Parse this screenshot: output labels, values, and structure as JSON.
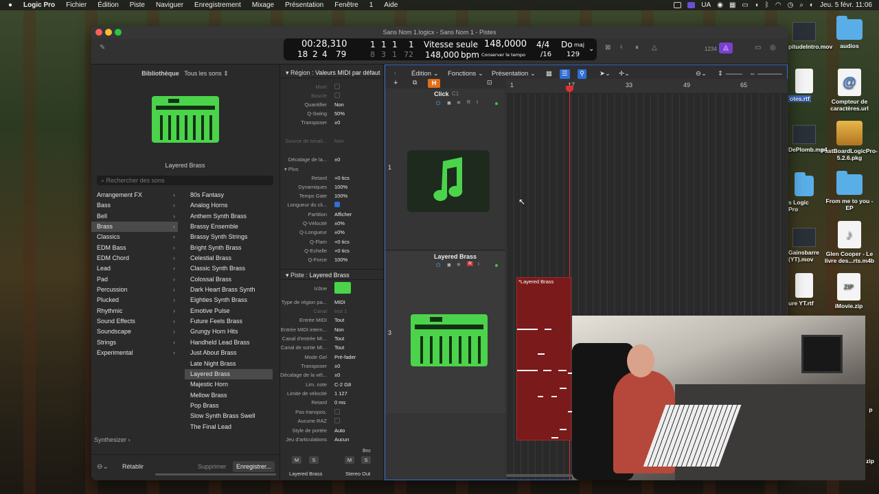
{
  "menubar": {
    "app": "Logic Pro",
    "items": [
      "Fichier",
      "Édition",
      "Piste",
      "Naviguer",
      "Enregistrement",
      "Mixage",
      "Présentation",
      "Fenêtre",
      "1",
      "Aide"
    ],
    "status": {
      "lang": "UA",
      "datetime": "Jeu. 5 févr. 11:06"
    }
  },
  "window": {
    "title": "Sans Nom 1.logicx - Sans Nom 1 - Pistes"
  },
  "lcd": {
    "time": "00:28,310",
    "bars_top": [
      "1",
      "1",
      "1",
      "1"
    ],
    "bars_bottom": [
      "18",
      "2",
      "4",
      "79"
    ],
    "bars2_bottom": [
      "8",
      "3",
      "1",
      "72"
    ],
    "tempo_label": "Vitesse seule",
    "tempo_top": "148,0000",
    "tempo_bottom": "148,000",
    "bpm": "bpm",
    "keep_tempo": "Conserver le tempo",
    "sig_top": "4/4",
    "sig_bottom": "/16",
    "key": "Do",
    "mode": "maj",
    "val": "129",
    "count_in": "1234"
  },
  "library": {
    "title": "Bibliothèque",
    "filter": "Tous les sons ⇕",
    "patch_name": "Layered Brass",
    "search_placeholder": "Rechercher des sons",
    "categories": [
      "Arrangement FX",
      "Bass",
      "Bell",
      "Brass",
      "Classics",
      "EDM Bass",
      "EDM Chord",
      "Lead",
      "Pad",
      "Percussion",
      "Plucked",
      "Rhythmic",
      "Sound Effects",
      "Soundscape",
      "Strings",
      "Experimental"
    ],
    "patches": [
      "80s Fantasy",
      "Analog Horns",
      "Anthem Synth Brass",
      "Brassy Ensemble",
      "Brassy Synth Strings",
      "Bright Synth Brass",
      "Celestial Brass",
      "Classic Synth Brass",
      "Colossal Brass",
      "Dark Heart Brass Synth",
      "Eighties Synth Brass",
      "Emotive Pulse",
      "Future Feels Brass",
      "Grungy Horn Hits",
      "Handheld Lead Brass",
      "Just About Brass",
      "Late Night Brass",
      "Layered Brass",
      "Majestic Horn",
      "Mellow Brass",
      "Pop Brass",
      "Slow Synth Brass Swell",
      "The Final Lead"
    ],
    "synth": "Synthesizer ›",
    "reset": "Rétablir",
    "delete": "Supprimer",
    "save": "Enregistrer..."
  },
  "inspector": {
    "region_label": "Région :",
    "region_value": "Valeurs MIDI par défaut",
    "region_rows": [
      [
        "Muet",
        ""
      ],
      [
        "Boucle",
        ""
      ],
      [
        "Quantifier",
        "Non"
      ],
      [
        "Q-Swing",
        "50%"
      ],
      [
        "Transposer",
        "±0"
      ],
      [
        "Source de tonali...",
        "Non"
      ],
      [
        "Décalage de la...",
        "±0"
      ]
    ],
    "plus": "Plus",
    "more_rows": [
      [
        "Retard",
        "+0 tics"
      ],
      [
        "Dynamiques",
        "100%"
      ],
      [
        "Temps Gate",
        "100%"
      ],
      [
        "Longueur du cli...",
        ""
      ],
      [
        "Partition",
        "Afficher"
      ],
      [
        "Q-Vélocité",
        "±0%"
      ],
      [
        "Q-Longueur",
        "±0%"
      ],
      [
        "Q-Flam",
        "+0 tics"
      ],
      [
        "Q-Echelle",
        "+0 tics"
      ],
      [
        "Q-Force",
        "100%"
      ]
    ],
    "track_label": "Piste :",
    "track_value": "Layered Brass",
    "track_rows": [
      [
        "Icône",
        ""
      ],
      [
        "Type de région pa...",
        "MIDI"
      ],
      [
        "Canal",
        "Inst 1"
      ],
      [
        "Entrée MIDI",
        "Tout"
      ],
      [
        "Entrée MIDI intern...",
        "Non"
      ],
      [
        "Canal d'entrée MI...",
        "Tout"
      ],
      [
        "Canal de sortie MI...",
        "Tout"
      ],
      [
        "Mode Gel",
        "Pré-fader"
      ],
      [
        "Transposer",
        "±0"
      ],
      [
        "Décalage de la vél...",
        "±0"
      ],
      [
        "Lim. note",
        "C-2  G8"
      ],
      [
        "Limite de vélocité",
        "1  127"
      ],
      [
        "Retard",
        "0 ms"
      ],
      [
        "Pas transpos.",
        ""
      ],
      [
        "Aucune RAZ",
        ""
      ],
      [
        "Style de portée",
        "Auto"
      ],
      [
        "Jeu d'articulations",
        "Aucun"
      ]
    ],
    "bnc": "Bnc",
    "m": "M",
    "s": "S",
    "strip1": "Layered Brass",
    "strip2": "Stereo Out"
  },
  "main": {
    "edit": "Édition",
    "functions": "Fonctions",
    "view": "Présentation",
    "tracks": [
      {
        "num": "1",
        "name": "Click",
        "sub": "C1"
      },
      {
        "num": "3",
        "name": "Layered Brass"
      }
    ],
    "ruler": [
      "1",
      "17",
      "33",
      "49",
      "65"
    ],
    "region_name": "*Layered Brass"
  },
  "desktop": [
    {
      "label": "audios",
      "icon": "folder-icon"
    },
    {
      "label": "Compteur de caractères.url",
      "icon": "document-icon"
    },
    {
      "label": "FastBoardLogicPro-5.2.6.pkg",
      "icon": "package-icon"
    },
    {
      "label": "From me to you - EP",
      "icon": "folder-icon"
    },
    {
      "label": "Glen Cooper - Le livre des...rts.m4b",
      "icon": "music-file-icon"
    },
    {
      "label": "iMovie.zip",
      "icon": "zip-icon"
    }
  ],
  "desktop_partial": [
    "pitudeIntro.mov",
    "otes.rtf",
    "DePlomb.mp4",
    "s Logic Pro",
    "Gainsbarre (YT).mov",
    "ure YT.rtf",
    "p",
    "zip"
  ]
}
